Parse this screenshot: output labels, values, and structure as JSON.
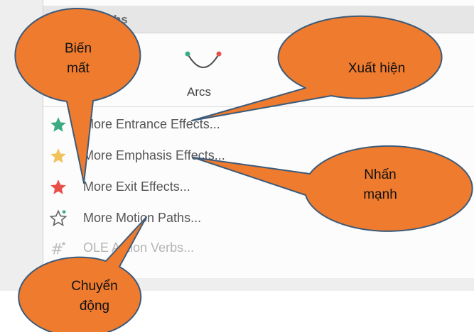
{
  "panel": {
    "header": "Motion Paths",
    "gallery": {
      "arcs_label": "Arcs"
    }
  },
  "menu": [
    {
      "label": "More Entrance Effects...",
      "icon": "green-star-icon"
    },
    {
      "label": "More Emphasis Effects...",
      "icon": "yellow-star-icon"
    },
    {
      "label": "More Exit Effects...",
      "icon": "red-star-icon"
    },
    {
      "label": "More Motion Paths...",
      "icon": "outline-star-motion-icon"
    },
    {
      "label": "OLE Action Verbs...",
      "icon": "ole-verbs-icon",
      "disabled": true
    }
  ],
  "callouts": {
    "bien_mat": [
      "Biến",
      "mất"
    ],
    "xuat_hien": "Xuất hiện",
    "nhan_manh": [
      "Nhấn",
      "mạnh"
    ],
    "chuyen_dong": [
      "Chuyển",
      "động"
    ]
  },
  "colors": {
    "callout_fill": "#EE7B2E",
    "callout_stroke": "#3D5B7A",
    "entrance_star": "#3CAB84",
    "emphasis_star": "#F2C25D",
    "exit_star": "#E8504A"
  }
}
